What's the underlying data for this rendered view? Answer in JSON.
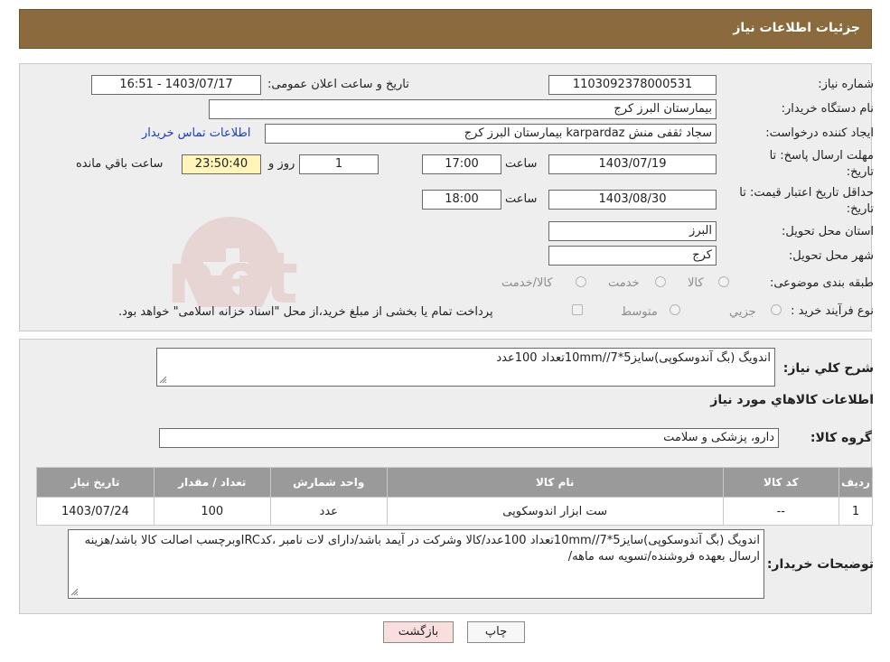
{
  "header": {
    "title": "جزئیات اطلاعات نیاز"
  },
  "form": {
    "need_number_label": "شماره نیاز:",
    "need_number": "1103092378000531",
    "announce_label": "تاریخ و ساعت اعلان عمومی:",
    "announce_value": "1403/07/17 - 16:51",
    "buyer_org_label": "نام دستگاه خریدار:",
    "buyer_org": "بیمارستان البرز کرج",
    "creator_label": "ایجاد کننده درخواست:",
    "creator": "سجاد ثقفی منش karpardaz بیمارستان البرز کرج",
    "contact_link": "اطلاعات تماس خریدار",
    "deadline_label_1": "مهلت ارسال پاسخ: تا",
    "deadline_label_2": "تاریخ:",
    "deadline_date": "1403/07/19",
    "time_label": "ساعت",
    "deadline_time": "17:00",
    "days_value": "1",
    "days_label": "روز و",
    "remaining_time": "23:50:40",
    "remaining_label": "ساعت باقي مانده",
    "validity_label_1": "حداقل تاریخ اعتبار قیمت: تا",
    "validity_label_2": "تاریخ:",
    "validity_date": "1403/08/30",
    "validity_time_label": "ساعت",
    "validity_time": "18:00",
    "province_label": "استان محل تحویل:",
    "province": "البرز",
    "city_label": "شهر محل تحویل:",
    "city": "کرج",
    "category_label": "طبقه بندی موضوعی:",
    "category_options": [
      "کالا",
      "خدمت",
      "کالا/خدمت"
    ],
    "process_label": "نوع فرآیند خرید :",
    "process_options": [
      "جزيي",
      "متوسط"
    ],
    "process_note": "پرداخت تمام یا بخشی از مبلغ خرید،از محل \"اسناد خزانه اسلامی\" خواهد بود."
  },
  "details": {
    "summary_label": "شرح کلي نياز:",
    "summary": "اندویگ (بگ آندوسکوپی)سایز5*10mm//7تعداد 100عدد",
    "items_title": "اطلاعات کالاهاي مورد نياز",
    "group_label": "گروه کالا:",
    "group_value": "دارو، پزشکی و سلامت",
    "table_headers": [
      "رديف",
      "کد کالا",
      "نام کالا",
      "واحد شمارش",
      "تعداد / مقدار",
      "تاریخ نیاز"
    ],
    "rows": [
      [
        "1",
        "--",
        "ست ابزار اندوسکوپی",
        "عدد",
        "100",
        "1403/07/24"
      ]
    ],
    "buyer_notes_label": "توضیحات خریدار:",
    "buyer_notes": "اندویگ (بگ آندوسکوپی)سایز5*10mm//7تعداد 100عدد/کالا وشرکت در آیمد باشد/دارای لات نامبر ،کدIRCوبرچسب اصالت کالا باشد/هزینه ارسال بعهده فروشنده/تسویه سه ماهه/"
  },
  "buttons": {
    "print": "چاپ",
    "back": "بازگشت"
  },
  "watermark": {
    "text": "AriaTender.net"
  },
  "colors": {
    "header": "#8b6b3d",
    "panel": "#eeeeee",
    "table_header": "#9a9a9a",
    "remaining_bg": "#fff5b8",
    "back_button_bg": "#f9dede",
    "link": "#1a3cc4"
  }
}
